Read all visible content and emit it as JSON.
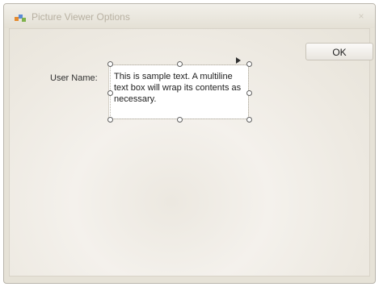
{
  "window": {
    "title": "Picture Viewer Options",
    "close_glyph": "×"
  },
  "icons": {
    "app": "app-icon",
    "close": "close-icon"
  },
  "form": {
    "ok_label": "OK",
    "user_name_label": "User Name:",
    "textbox_text": "This is sample text. A multiline text box will wrap its contents as necessary."
  }
}
